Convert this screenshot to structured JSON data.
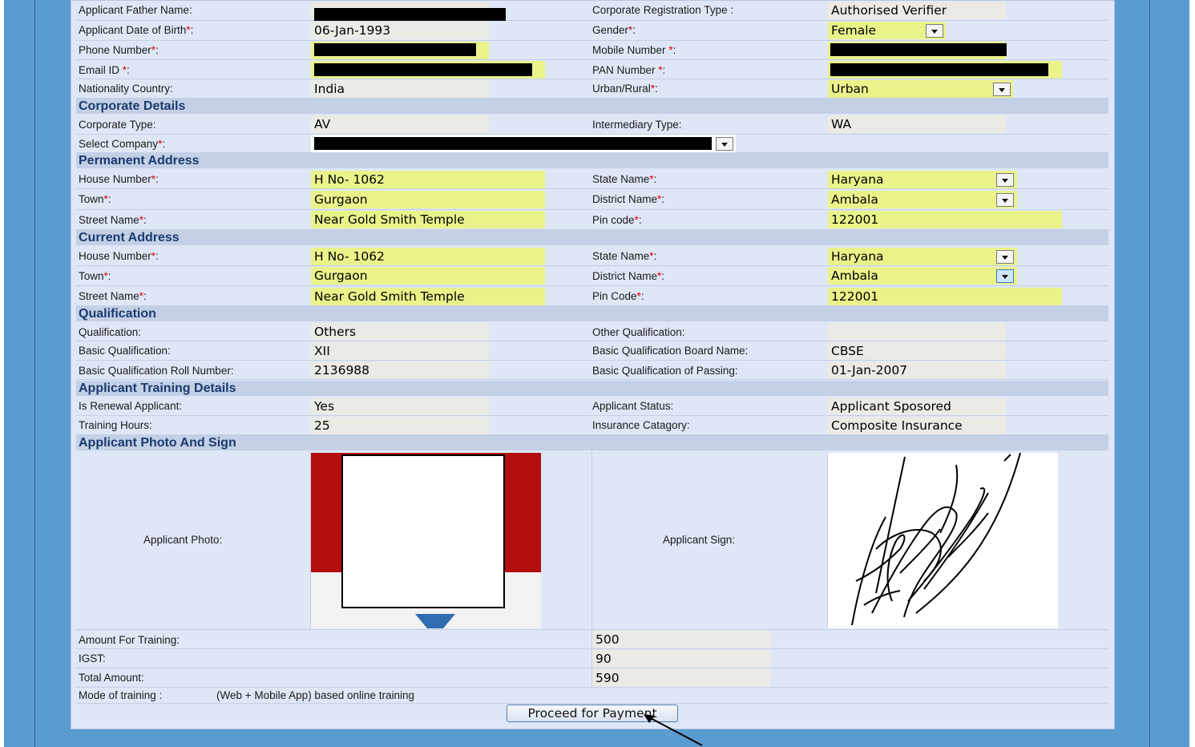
{
  "rows": {
    "father": {
      "label": "Applicant Father Name:",
      "value": ""
    },
    "reg_type": {
      "label": "Corporate Registration Type :",
      "value": "Authorised Verifier"
    },
    "dob": {
      "label": "Applicant Date of Birth",
      "value": "06-Jan-1993"
    },
    "gender": {
      "label": "Gender",
      "value": "Female"
    },
    "phone": {
      "label": "Phone Number",
      "value": ""
    },
    "mobile": {
      "label": "Mobile Number ",
      "value": ""
    },
    "email": {
      "label": "Email ID ",
      "value": ""
    },
    "pan": {
      "label": "PAN Number ",
      "value": ""
    },
    "nationality": {
      "label": "Nationality Country:",
      "value": "India"
    },
    "urban": {
      "label": "Urban/Rural",
      "value": "Urban"
    }
  },
  "corporate": {
    "title": "Corporate Details",
    "type_label": "Corporate Type:",
    "type_value": "AV",
    "intermediary_label": "Intermediary Type:",
    "intermediary_value": "WA",
    "company_label": "Select Company"
  },
  "permanent": {
    "title": "Permanent Address",
    "house_label": "House Number",
    "house": "H No- 1062",
    "state_label": "State Name",
    "state": "Haryana",
    "town_label": "Town",
    "town": "Gurgaon",
    "district_label": "District Name",
    "district": "Ambala",
    "street_label": "Street Name",
    "street": "Near Gold Smith Temple",
    "pin_label": "Pin code",
    "pin": "122001"
  },
  "current": {
    "title": "Current Address",
    "house_label": "House Number",
    "house": "H No- 1062",
    "state_label": "State Name",
    "state": "Haryana",
    "town_label": "Town",
    "town": "Gurgaon",
    "district_label": "District Name",
    "district": "Ambala",
    "street_label": "Street Name",
    "street": "Near Gold Smith Temple",
    "pin_label": "Pin Code",
    "pin": "122001"
  },
  "qualification": {
    "title": "Qualification",
    "qual_label": "Qualification:",
    "qual": "Others",
    "other_label": "Other Qualification:",
    "other": "",
    "basic_label": "Basic Qualification:",
    "basic": "XII",
    "board_label": "Basic Qualification Board Name:",
    "board": "CBSE",
    "roll_label": "Basic Qualification Roll Number:",
    "roll": "2136988",
    "passing_label": "Basic Qualification of Passing:",
    "passing": "01-Jan-2007"
  },
  "training": {
    "title": "Applicant Training Details",
    "renewal_label": "Is Renewal Applicant:",
    "renewal": "Yes",
    "status_label": "Applicant Status:",
    "status": "Applicant Sposored",
    "hours_label": "Training Hours:",
    "hours": "25",
    "insurance_label": "Insurance Catagory:",
    "insurance": "Composite Insurance"
  },
  "photo_sign": {
    "title": "Applicant Photo And Sign",
    "photo_label": "Applicant Photo:",
    "sign_label": "Applicant Sign:"
  },
  "payment": {
    "amount_label": "Amount For Training:",
    "amount": "500",
    "igst_label": "IGST:",
    "igst": "90",
    "total_label": "Total Amount:",
    "total": "590",
    "mode_label": "Mode of training :",
    "mode": "(Web + Mobile App) based online training",
    "button": "Proceed for Payment"
  },
  "required_mark": "*",
  "colors": {
    "field_required": "#eaf28a",
    "field_readonly": "#ebeae5",
    "section_bg": "#c4d0e6",
    "page_bg": "#5a9bd0"
  }
}
